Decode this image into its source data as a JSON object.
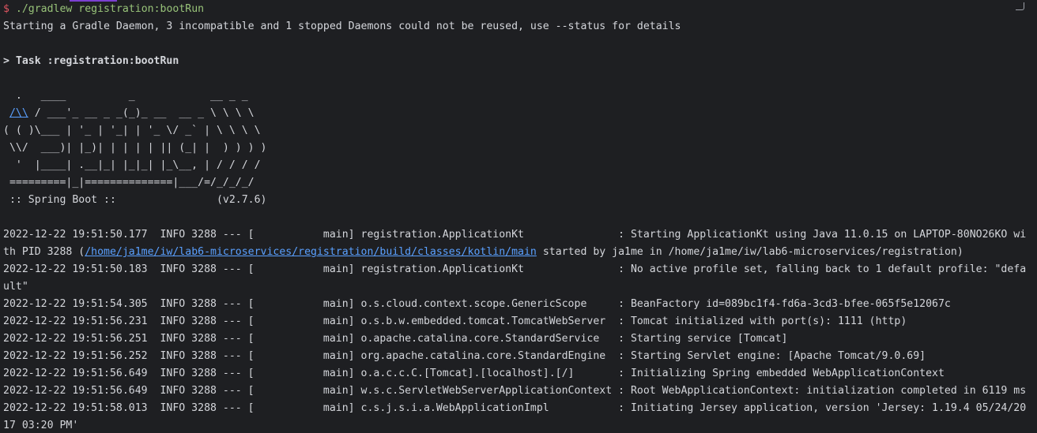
{
  "prompt": {
    "symbol": "$",
    "command": "./gradlew registration:bootRun"
  },
  "daemon_message": "Starting a Gradle Daemon, 3 incompatible and 1 stopped Daemons could not be reused, use --status for details",
  "task_line": "> Task :registration:bootRun",
  "banner": {
    "l1": "  .   ____          _            __ _ _",
    "l2_link": "/\\\\",
    "l2_rest": " / ___'_ __ _ _(_)_ __  __ _ \\ \\ \\ \\",
    "l3": "( ( )\\___ | '_ | '_| | '_ \\/ _` | \\ \\ \\ \\",
    "l4": " \\\\/  ___)| |_)| | | | | || (_| |  ) ) ) )",
    "l5": "  '  |____| .__|_| |_|_| |_\\__, | / / / /",
    "l6": " =========|_|==============|___/=/_/_/_/",
    "l7": " :: Spring Boot ::                (v2.7.6)"
  },
  "logs": [
    {
      "text": "2022-12-22 19:51:50.177  INFO 3288 --- [           main] registration.ApplicationKt               : Starting ApplicationKt using Java 11.0.15 on LAPTOP-80NO26KO wi"
    },
    {
      "pre": "th PID 3288 (",
      "link": "/home/ja1me/iw/lab6-microservices/registration/build/classes/kotlin/main",
      "post": " started by ja1me in /home/ja1me/iw/lab6-microservices/registration)"
    },
    {
      "text": "2022-12-22 19:51:50.183  INFO 3288 --- [           main] registration.ApplicationKt               : No active profile set, falling back to 1 default profile: \"defa"
    },
    {
      "text": "ult\""
    },
    {
      "text": "2022-12-22 19:51:54.305  INFO 3288 --- [           main] o.s.cloud.context.scope.GenericScope     : BeanFactory id=089bc1f4-fd6a-3cd3-bfee-065f5e12067c"
    },
    {
      "text": "2022-12-22 19:51:56.231  INFO 3288 --- [           main] o.s.b.w.embedded.tomcat.TomcatWebServer  : Tomcat initialized with port(s): 1111 (http)"
    },
    {
      "text": "2022-12-22 19:51:56.251  INFO 3288 --- [           main] o.apache.catalina.core.StandardService   : Starting service [Tomcat]"
    },
    {
      "text": "2022-12-22 19:51:56.252  INFO 3288 --- [           main] org.apache.catalina.core.StandardEngine  : Starting Servlet engine: [Apache Tomcat/9.0.69]"
    },
    {
      "text": "2022-12-22 19:51:56.649  INFO 3288 --- [           main] o.a.c.c.C.[Tomcat].[localhost].[/]       : Initializing Spring embedded WebApplicationContext"
    },
    {
      "text": "2022-12-22 19:51:56.649  INFO 3288 --- [           main] w.s.c.ServletWebServerApplicationContext : Root WebApplicationContext: initialization completed in 6119 ms"
    },
    {
      "text": "2022-12-22 19:51:58.013  INFO 3288 --- [           main] c.s.j.s.i.a.WebApplicationImpl           : Initiating Jersey application, version 'Jersey: 1.19.4 05/24/20"
    },
    {
      "text": "17 03:20 PM'"
    }
  ]
}
